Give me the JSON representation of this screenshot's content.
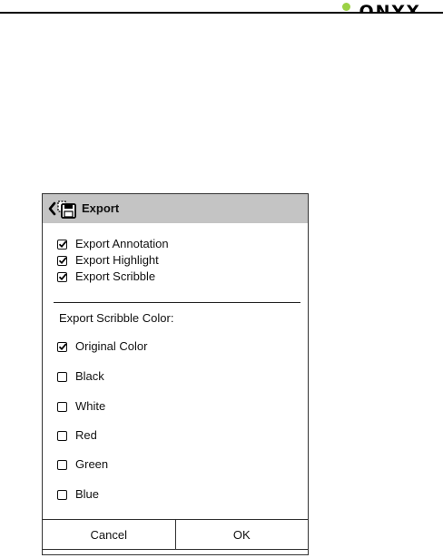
{
  "brand": {
    "name": "ONYX"
  },
  "dialog": {
    "title": "Export",
    "back_icon": "chevron-left-icon",
    "title_icon": "export-icon",
    "export_options": [
      {
        "label": "Export Annotation",
        "checked": true
      },
      {
        "label": "Export Highlight",
        "checked": true
      },
      {
        "label": "Export Scribble",
        "checked": true
      }
    ],
    "scribble_color_label": "Export Scribble Color:",
    "colors": [
      {
        "label": "Original Color",
        "checked": true
      },
      {
        "label": "Black",
        "checked": false
      },
      {
        "label": "White",
        "checked": false
      },
      {
        "label": "Red",
        "checked": false
      },
      {
        "label": "Green",
        "checked": false
      },
      {
        "label": "Blue",
        "checked": false
      }
    ],
    "cancel_label": "Cancel",
    "ok_label": "OK"
  },
  "colors": {
    "header_bg": "#c4c4c4",
    "brand_accent": "#9bd245"
  }
}
